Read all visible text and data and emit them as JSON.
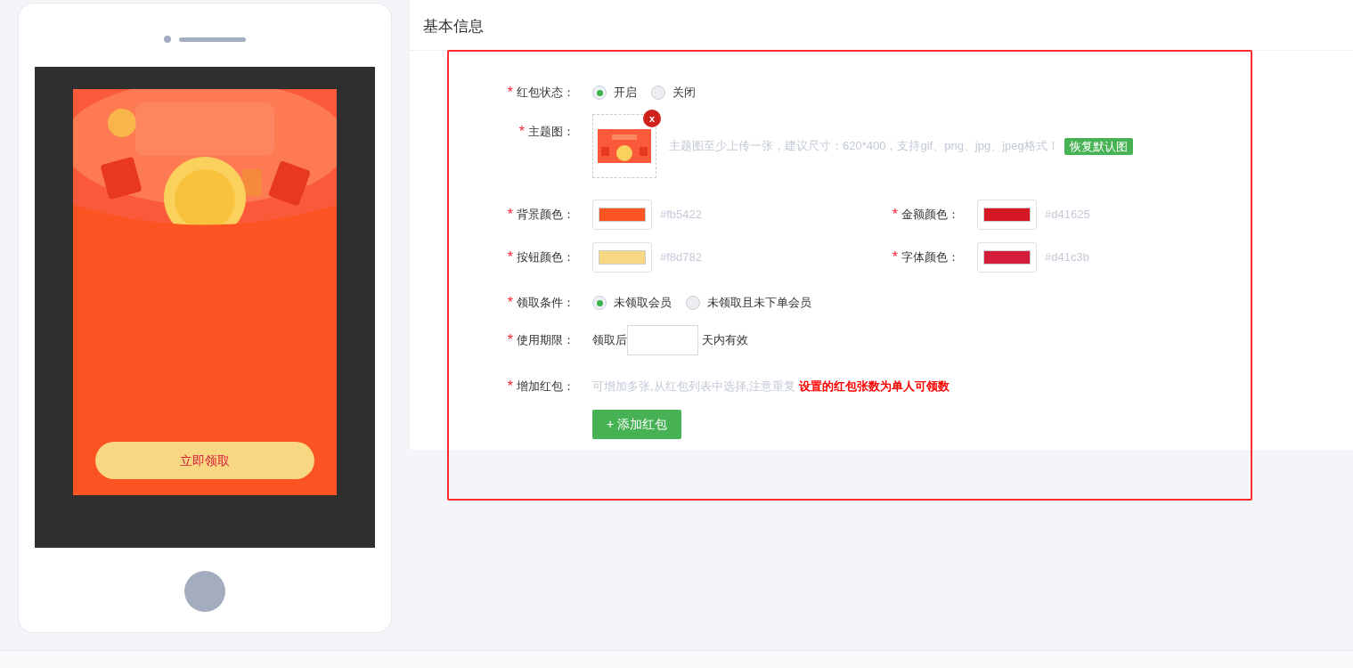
{
  "preview": {
    "button_label": "立即领取"
  },
  "panel": {
    "title": "基本信息"
  },
  "form": {
    "status": {
      "label": "红包状态：",
      "mark": "*",
      "options": [
        {
          "label": "开启",
          "selected": true
        },
        {
          "label": "关闭",
          "selected": false
        }
      ]
    },
    "theme_image": {
      "label": "主题图：",
      "mark": "*",
      "hint": "主题图至少上传一张，建议尺寸：620*400，支持gif、png、jpg、jpeg格式！",
      "remove": "x",
      "restore": "恢复默认图"
    },
    "colors": [
      {
        "label": "背景颜色：",
        "mark": "*",
        "value": "#fb5422"
      },
      {
        "label": "金额颜色：",
        "mark": "*",
        "value": "#d41625"
      },
      {
        "label": "按钮颜色：",
        "mark": "*",
        "value": "#f8d782"
      },
      {
        "label": "字体颜色：",
        "mark": "*",
        "value": "#d41c3b"
      }
    ],
    "condition": {
      "label": "领取条件：",
      "mark": "*",
      "options": [
        {
          "label": "未领取会员",
          "selected": true
        },
        {
          "label": "未领取且未下单会员",
          "selected": false
        }
      ]
    },
    "validity": {
      "label": "使用期限：",
      "mark": "*",
      "prefix": "领取后",
      "suffix": "天内有效"
    },
    "add": {
      "label": "增加红包：",
      "mark": "*",
      "hint": "可增加多张,从红包列表中选择,注意重复 **设置的红包张数为单人可领数**",
      "button": "+ 添加红包"
    }
  }
}
